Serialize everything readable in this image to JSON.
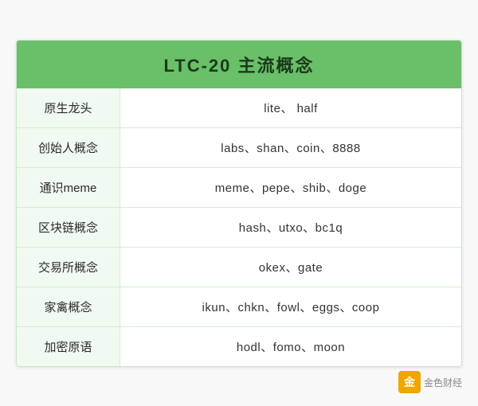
{
  "page": {
    "background": "#f8f8f8"
  },
  "header": {
    "title": "LTC-20  主流概念",
    "bg_color": "#6abf69"
  },
  "rows": [
    {
      "label": "原生龙头",
      "value": "lite、 half"
    },
    {
      "label": "创始人概念",
      "value": "labs、shan、coin、8888"
    },
    {
      "label": "通识meme",
      "value": "meme、pepe、shib、doge"
    },
    {
      "label": "区块链概念",
      "value": "hash、utxo、bc1q"
    },
    {
      "label": "交易所概念",
      "value": "okex、gate"
    },
    {
      "label": "家禽概念",
      "value": "ikun、chkn、fowl、eggs、coop"
    },
    {
      "label": "加密原语",
      "value": "hodl、fomo、moon"
    }
  ],
  "watermark": {
    "icon_label": "金",
    "text": "金色财经"
  }
}
